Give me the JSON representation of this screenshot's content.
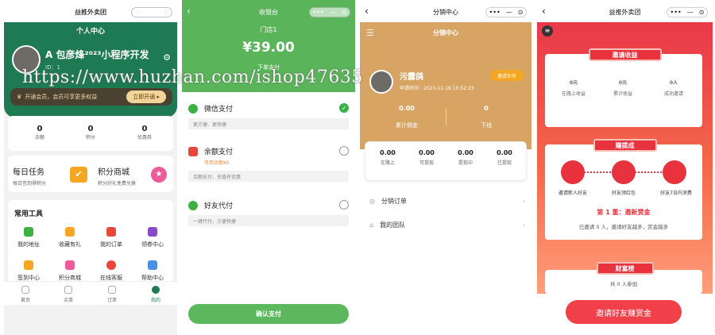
{
  "p1": {
    "app_title": "益推外卖团",
    "page_title": "个人中心",
    "name": "A 包彦烽²⁰²³小程序开发",
    "id": "ID：1",
    "vip_text": "开通会员，会员可享更多权益",
    "vip_btn": "立即开通 ▸",
    "stats": [
      {
        "v": "0",
        "l": "余额"
      },
      {
        "v": "0",
        "l": "积分"
      },
      {
        "v": "0",
        "l": "优惠券"
      }
    ],
    "task_title": "每日任务",
    "task_sub": "每日签到得积分",
    "mall_title": "积分商城",
    "mall_sub": "积分好礼免费兑换",
    "tools_title": "常用工具",
    "tools": [
      "我的地址",
      "收藏有礼",
      "我的订单",
      "领券中心",
      "签到中心",
      "积分商城",
      "在线客服",
      "帮助中心"
    ],
    "tabs": [
      "首页",
      "点单",
      "订单",
      "我的"
    ]
  },
  "p2": {
    "title": "收银台",
    "store": "门店1",
    "amount": "¥39.00",
    "subtitle": "下单支付",
    "methods": [
      {
        "name": "微信支付",
        "note": "更方便、更快捷",
        "extra": ""
      },
      {
        "name": "余额支付",
        "note": "余额支付、充值有优惠",
        "extra": "可用余额¥0"
      },
      {
        "name": "好友代付",
        "note": "一键代付，方便快捷",
        "extra": ""
      }
    ],
    "confirm": "确认支付"
  },
  "p3": {
    "title": "分销中心",
    "nav_title": "分销中心",
    "name": "污露鸽",
    "apply_time": "申请时间：2023-11-16 10:52:23",
    "invite_btn": "邀请伙伴",
    "summary": [
      {
        "v": "0.00",
        "l": "累计佣金"
      },
      {
        "v": "0",
        "l": "下线"
      }
    ],
    "amounts": [
      {
        "v": "0.00",
        "l": "在路上"
      },
      {
        "v": "0.00",
        "l": "可提现"
      },
      {
        "v": "0.00",
        "l": "提现中"
      },
      {
        "v": "0.00",
        "l": "已提现"
      }
    ],
    "menu": [
      "分销订单",
      "我的团队"
    ]
  },
  "p4": {
    "app_title": "益推外卖团",
    "ribbon1": "邀请收益",
    "income": [
      {
        "v": "0",
        "u": "元",
        "l": "在路上收益"
      },
      {
        "v": "0",
        "u": "元",
        "l": "累计收益"
      },
      {
        "v": "0",
        "u": "人",
        "l": "成功邀请"
      }
    ],
    "ribbon2": "赚提成",
    "steps": [
      "邀请新人好友",
      "好友领红包",
      "好友7日内消费"
    ],
    "reward_title": "第 1 重：邀新赏金",
    "reward_num": "1",
    "reward_text": "已邀请 0 人，邀请好友越多，赏金越多",
    "ribbon3": "财富榜",
    "rank_text": "共 0 人参加",
    "invite_btn": "邀请好友赚赏金"
  },
  "watermark": "https://www.huzhan.com/ishop47635",
  "colors": {
    "green_dark": "#1e7a52",
    "green_pay": "#5ab55a",
    "gold": "#d8a464",
    "red": "#e8333e"
  }
}
